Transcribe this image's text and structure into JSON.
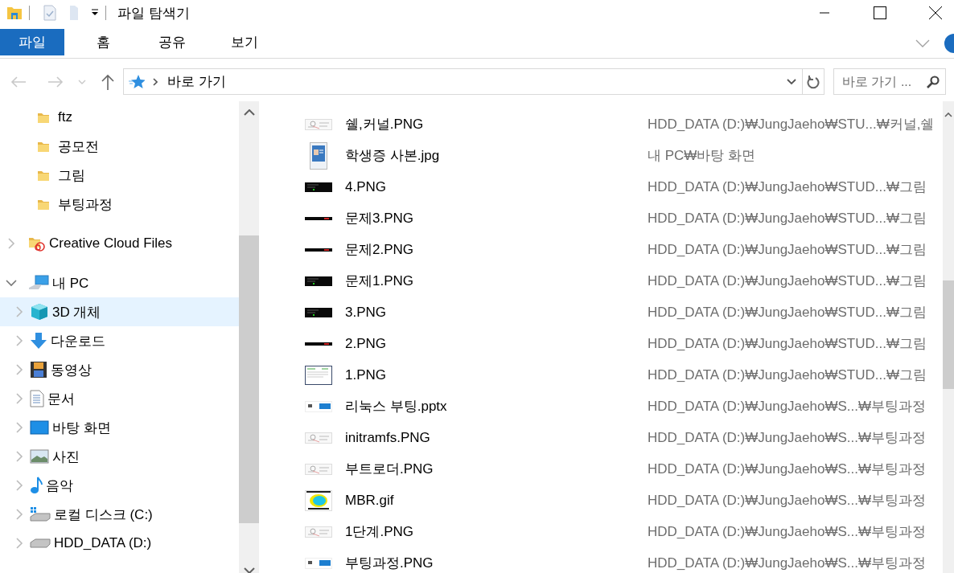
{
  "window": {
    "title": "파일 탐색기"
  },
  "ribbon": {
    "tabs": [
      {
        "label": "파일",
        "selected": true
      },
      {
        "label": "홈",
        "selected": false
      },
      {
        "label": "공유",
        "selected": false
      },
      {
        "label": "보기",
        "selected": false
      }
    ]
  },
  "address_bar": {
    "path": "바로 가기",
    "search": {
      "placeholder": "바로 가기 ..."
    }
  },
  "navigation_pane": {
    "pinned_folders": [
      {
        "label": "ftz",
        "selected": false
      },
      {
        "label": "공모전",
        "selected": false
      },
      {
        "label": "그림",
        "selected": false
      },
      {
        "label": "부팅과정",
        "selected": false
      }
    ],
    "tree": [
      {
        "label": "Creative Cloud Files",
        "kind": "cloud",
        "expanded": false,
        "selected": false
      },
      {
        "label": "내 PC",
        "kind": "pc",
        "expanded": true,
        "selected": false,
        "children": [
          {
            "label": "3D 개체",
            "kind": "cube",
            "expanded": false,
            "selected": true
          },
          {
            "label": "다운로드",
            "kind": "download",
            "expanded": false,
            "selected": false
          },
          {
            "label": "동영상",
            "kind": "video",
            "expanded": false,
            "selected": false
          },
          {
            "label": "문서",
            "kind": "document",
            "expanded": false,
            "selected": false
          },
          {
            "label": "바탕 화면",
            "kind": "desktop",
            "expanded": false,
            "selected": false
          },
          {
            "label": "사진",
            "kind": "picture",
            "expanded": false,
            "selected": false
          },
          {
            "label": "음악",
            "kind": "music",
            "expanded": false,
            "selected": false
          },
          {
            "label": "로컬 디스크 (C:)",
            "kind": "system-drive",
            "expanded": false,
            "selected": false
          },
          {
            "label": "HDD_DATA (D:)",
            "kind": "drive",
            "expanded": false,
            "selected": false
          }
        ]
      }
    ]
  },
  "files": [
    {
      "name": "쉘,커널.PNG",
      "location": "HDD_DATA (D:)₩JungJaeho₩STU...₩커널,쉘",
      "kind": "diagram",
      "selected": false
    },
    {
      "name": "학생증 사본.jpg",
      "location": "내 PC₩바탕 화면",
      "kind": "portrait",
      "selected": false
    },
    {
      "name": "4.PNG",
      "location": "HDD_DATA (D:)₩JungJaeho₩STUD...₩그림",
      "kind": "terminal",
      "selected": false
    },
    {
      "name": "문제3.PNG",
      "location": "HDD_DATA (D:)₩JungJaeho₩STUD...₩그림",
      "kind": "strip",
      "selected": false
    },
    {
      "name": "문제2.PNG",
      "location": "HDD_DATA (D:)₩JungJaeho₩STUD...₩그림",
      "kind": "strip",
      "selected": false
    },
    {
      "name": "문제1.PNG",
      "location": "HDD_DATA (D:)₩JungJaeho₩STUD...₩그림",
      "kind": "terminal",
      "selected": false
    },
    {
      "name": "3.PNG",
      "location": "HDD_DATA (D:)₩JungJaeho₩STUD...₩그림",
      "kind": "terminal",
      "selected": false
    },
    {
      "name": "2.PNG",
      "location": "HDD_DATA (D:)₩JungJaeho₩STUD...₩그림",
      "kind": "strip",
      "selected": false
    },
    {
      "name": "1.PNG",
      "location": "HDD_DATA (D:)₩JungJaeho₩STUD...₩그림",
      "kind": "screen",
      "selected": false
    },
    {
      "name": "리눅스 부팅.pptx",
      "location": "HDD_DATA (D:)₩JungJaeho₩S...₩부팅과정",
      "kind": "slide",
      "selected": false
    },
    {
      "name": "initramfs.PNG",
      "location": "HDD_DATA (D:)₩JungJaeho₩S...₩부팅과정",
      "kind": "diagram",
      "selected": false
    },
    {
      "name": "부트로더.PNG",
      "location": "HDD_DATA (D:)₩JungJaeho₩S...₩부팅과정",
      "kind": "diagram",
      "selected": false
    },
    {
      "name": "MBR.gif",
      "location": "HDD_DATA (D:)₩JungJaeho₩S...₩부팅과정",
      "kind": "disk",
      "selected": false
    },
    {
      "name": "1단계.PNG",
      "location": "HDD_DATA (D:)₩JungJaeho₩S...₩부팅과정",
      "kind": "diagram",
      "selected": false
    },
    {
      "name": "부팅과정.PNG",
      "location": "HDD_DATA (D:)₩JungJaeho₩S...₩부팅과정",
      "kind": "slide",
      "selected": false
    }
  ]
}
